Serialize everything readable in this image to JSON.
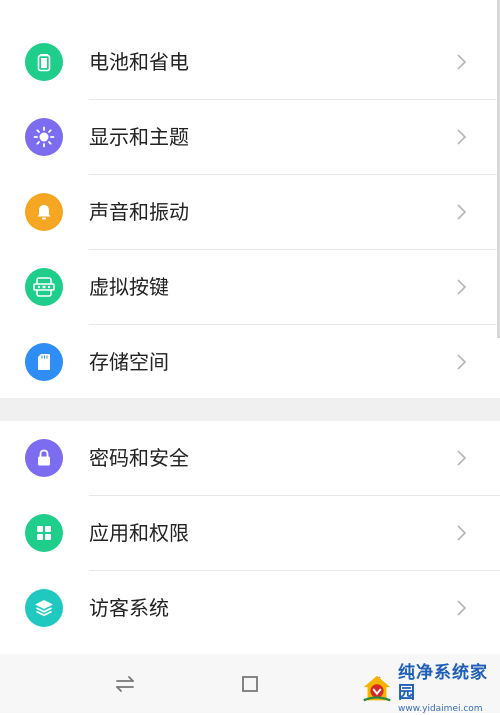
{
  "settings": {
    "section1": [
      {
        "label": "电池和省电",
        "icon": "battery-icon",
        "color": "#1fce8b"
      },
      {
        "label": "显示和主题",
        "icon": "brightness-icon",
        "color": "#7c6cf0"
      },
      {
        "label": "声音和振动",
        "icon": "bell-icon",
        "color": "#f5a623"
      },
      {
        "label": "虚拟按键",
        "icon": "virtual-keys-icon",
        "color": "#1fce8b"
      },
      {
        "label": "存储空间",
        "icon": "sd-card-icon",
        "color": "#2f8ef5"
      }
    ],
    "section2": [
      {
        "label": "密码和安全",
        "icon": "lock-icon",
        "color": "#7c6cf0"
      },
      {
        "label": "应用和权限",
        "icon": "apps-grid-icon",
        "color": "#1fce8b"
      },
      {
        "label": "访客系统",
        "icon": "layers-icon",
        "color": "#1fc9c0"
      }
    ]
  },
  "navbar": {
    "buttons": [
      "switch-icon",
      "home-square-icon",
      "back-icon"
    ]
  },
  "watermark": {
    "title": "纯净系统家园",
    "url": "www.yidaimei.com"
  }
}
